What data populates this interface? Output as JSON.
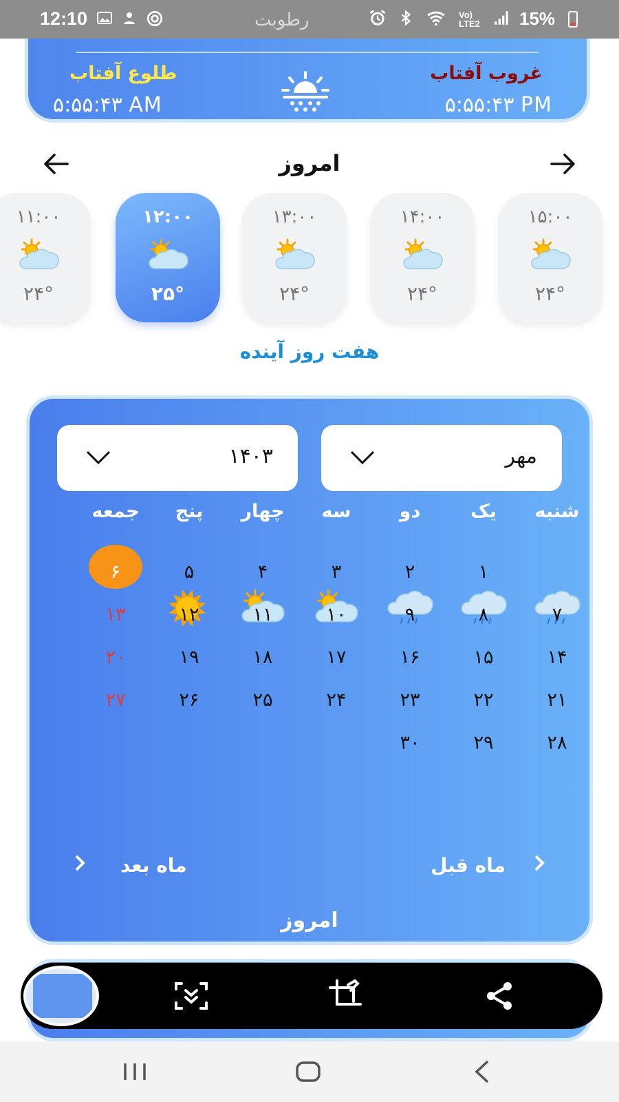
{
  "status_bar": {
    "time": "12:10",
    "center_text": "رطوبت",
    "battery": "15%",
    "icons": [
      "gallery-icon",
      "person-icon",
      "target-icon",
      "alarm-icon",
      "bluetooth-icon",
      "wifi-icon",
      "volte-icon",
      "signal-icon",
      "battery-icon"
    ]
  },
  "sun": {
    "sunrise_label": "طلوع آفتاب",
    "sunrise_time": "۵:۵۵:۴۳ AM",
    "sunset_label": "غروب آفتاب",
    "sunset_time": "۵:۵۵:۴۳ PM",
    "sunrise_color": "#ffe94a",
    "sunset_color": "#8a0d0d"
  },
  "today_nav": {
    "title": "امروز"
  },
  "hourly": [
    {
      "time": "۱۱:۰۰",
      "temp": "۲۴°",
      "icon": "partly-cloudy-icon",
      "active": false
    },
    {
      "time": "۱۲:۰۰",
      "temp": "۲۵°",
      "icon": "partly-cloudy-icon",
      "active": true
    },
    {
      "time": "۱۳:۰۰",
      "temp": "۲۴°",
      "icon": "partly-cloudy-icon",
      "active": false
    },
    {
      "time": "۱۴:۰۰",
      "temp": "۲۴°",
      "icon": "partly-cloudy-icon",
      "active": false
    },
    {
      "time": "۱۵:۰۰",
      "temp": "۲۴°",
      "icon": "partly-cloudy-icon",
      "active": false
    }
  ],
  "seven_days_link": "هفت روز آینده",
  "calendar": {
    "year": "۱۴۰۳",
    "month": "مهر",
    "weekdays": [
      "شنبه",
      "یک",
      "دو",
      "سه",
      "چهار",
      "پنج",
      "جمعه"
    ],
    "weeks": [
      [
        "",
        "۱",
        "۲",
        "۳",
        "۴",
        "۵",
        "۶"
      ],
      [
        "۷",
        "۸",
        "۹",
        "۱۰",
        "۱۱",
        "۱۲",
        "۱۳"
      ],
      [
        "۱۴",
        "۱۵",
        "۱۶",
        "۱۷",
        "۱۸",
        "۱۹",
        "۲۰"
      ],
      [
        "۲۱",
        "۲۲",
        "۲۳",
        "۲۴",
        "۲۵",
        "۲۶",
        "۲۷"
      ],
      [
        "۲۸",
        "۲۹",
        "۳۰",
        "",
        "",
        "",
        ""
      ]
    ],
    "today_day": "۶",
    "weather_days": {
      "۷": "rain-cloud-icon",
      "۸": "rain-cloud-icon",
      "۹": "rain-cloud-icon",
      "۱۰": "partly-cloudy-icon",
      "۱۱": "partly-cloudy-icon",
      "۱۲": "sun-icon"
    },
    "next_month": "ماه بعد",
    "prev_month": "ماه قبل",
    "today_button": "امروز",
    "today_color": "#f79418",
    "holiday_color": "#e03b3b"
  },
  "screenshot_toolbar": {
    "buttons": [
      "scroll-capture-icon",
      "crop-edit-icon",
      "share-icon"
    ]
  },
  "nav_bar": {
    "buttons": [
      "recents-icon",
      "home-icon",
      "back-icon"
    ]
  }
}
